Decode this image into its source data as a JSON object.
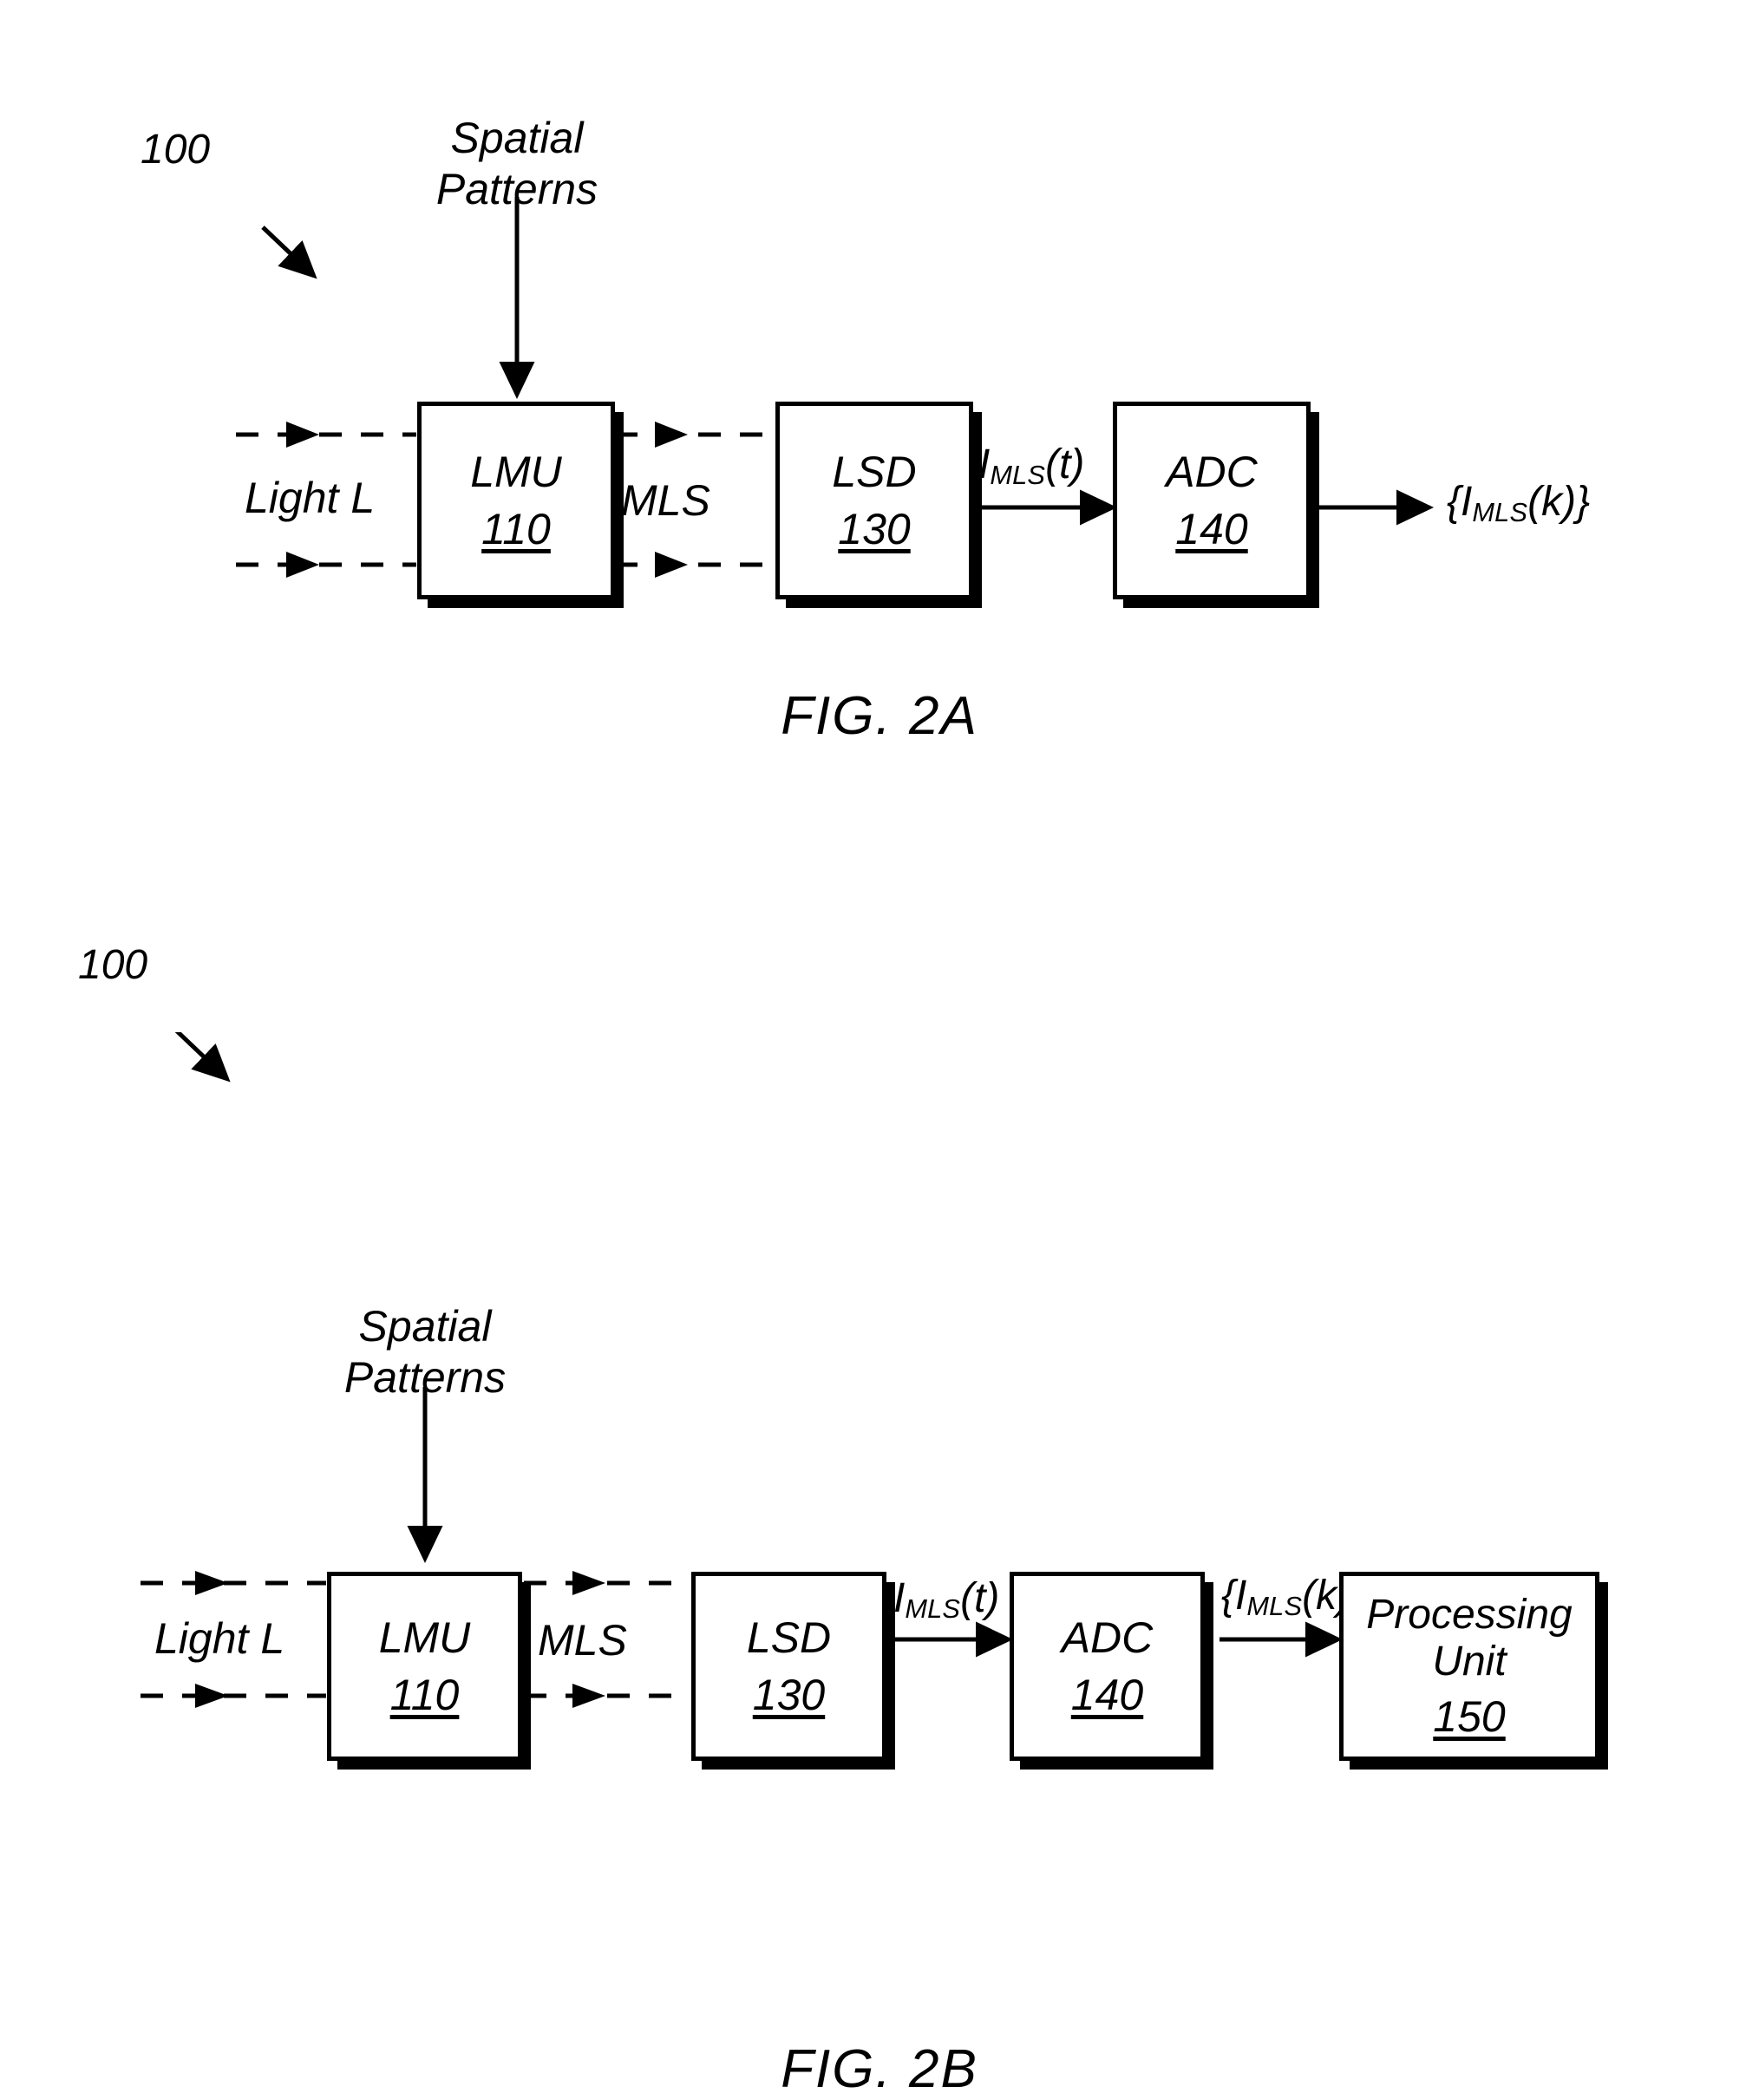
{
  "document": {
    "type": "patent-figure-sheet",
    "figures": [
      {
        "id": "fig2a",
        "caption": "FIG. 2A",
        "system_reference": "100",
        "input_label": "Light L",
        "control_label_line1": "Spatial",
        "control_label_line2": "Patterns",
        "signals": {
          "lmu_to_lsd": "MLS",
          "lsd_to_adc_main": "I",
          "lsd_to_adc_sub": "MLS",
          "lsd_to_adc_tail": "(t)",
          "adc_output_main": "{I",
          "adc_output_sub": "MLS",
          "adc_output_tail": "(k)}"
        },
        "blocks": [
          {
            "label": "LMU",
            "number": "110"
          },
          {
            "label": "LSD",
            "number": "130"
          },
          {
            "label": "ADC",
            "number": "140"
          }
        ]
      },
      {
        "id": "fig2b",
        "caption": "FIG. 2B",
        "system_reference": "100",
        "input_label": "Light L",
        "control_label_line1": "Spatial",
        "control_label_line2": "Patterns",
        "signals": {
          "lmu_to_lsd": "MLS",
          "lsd_to_adc_main": "I",
          "lsd_to_adc_sub": "MLS",
          "lsd_to_adc_tail": "(t)",
          "adc_to_pu_main": "{I",
          "adc_to_pu_sub": "MLS",
          "adc_to_pu_tail": "(k)}"
        },
        "blocks": [
          {
            "label": "LMU",
            "number": "110"
          },
          {
            "label": "LSD",
            "number": "130"
          },
          {
            "label": "ADC",
            "number": "140"
          },
          {
            "label_line1": "Processing",
            "label_line2": "Unit",
            "number": "150"
          }
        ]
      }
    ],
    "colors": {
      "ink": "#000000",
      "background": "#ffffff"
    }
  }
}
